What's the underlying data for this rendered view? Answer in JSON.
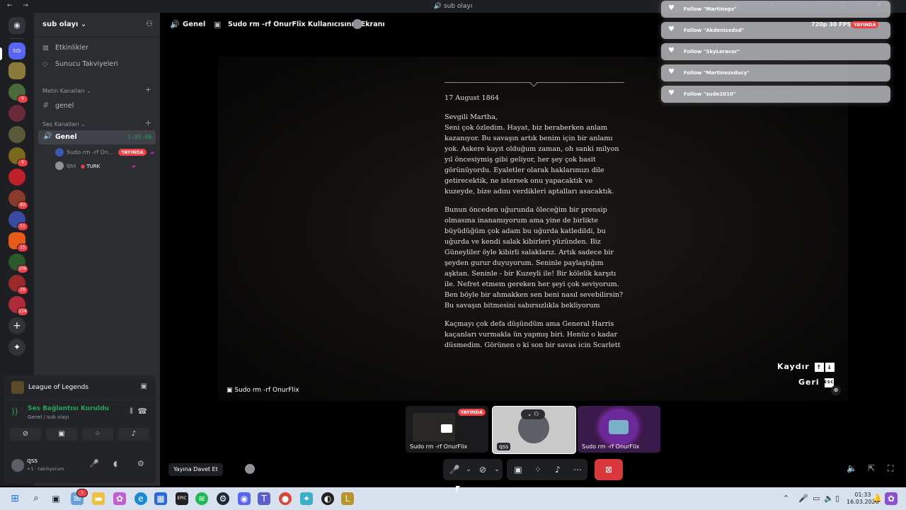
{
  "window": {
    "title": "sub olayı"
  },
  "server": {
    "name": "sub olayı"
  },
  "sidebar": {
    "top_items": [
      {
        "icon": "calendar-icon",
        "label": "Etkinlikler"
      },
      {
        "icon": "boost-icon",
        "label": "Sunucu Takviyeleri"
      }
    ],
    "text_category": "Metin Kanalları",
    "text_channel": "genel",
    "voice_category": "Ses Kanalları",
    "voice_channel": {
      "name": "Genel",
      "time": "1:05:09"
    },
    "voice_users": [
      {
        "name": "Sudo rm -rf On...",
        "badge": "YAYINDA"
      },
      {
        "name": "qss",
        "tag": "TURK"
      }
    ]
  },
  "guild_badges": [
    "9",
    "9",
    "80",
    "51",
    "15",
    "106",
    "29",
    "124"
  ],
  "panel": {
    "game": "League of Legends",
    "connection": {
      "status": "Ses Bağlantısı Kuruldu",
      "location": "Genel / sub olayı"
    },
    "user": {
      "name": "qss",
      "status": "+1 · takılıyorum"
    }
  },
  "header": {
    "channel": "Genel",
    "stream_title": "Sudo rm -rf OnurFlix Kullanıcısının Ekranı"
  },
  "letter": {
    "date": "17 August 1864",
    "paragraphs": [
      "Sevgili Martha,\nSeni çok özledim. Hayat, biz beraberken anlam kazanıyor. Bu savaşın artık benim için bir anlamı yok. Askere kayıt olduğum zaman, oh sanki milyon yıl öncesiymiş gibi geliyor, her şey çok basit görünüyordu. Eyaletler olarak haklarımızı dile getirecektik, ne istersek onu yapacaktık ve kuzeyde, bize adını verdikleri aptalları asacaktık.",
      "Bunun önceden uğurunda öleceğim bir prensip olmasına inanamıyorum ama yine de birlikte büyüdüğüm çok adam bu uğurda katledildi, bu uğurda ve kendi salak kibirleri yüzünden. Biz Güneyliler öyle kibirli salaklarız. Artık sadece bir şeyden gurur duyuyorum. Seninle paylaştığım aşktan. Seninle - bir Kuzeyli ile! Bir kölelik karşıtı ile. Nefret etmem gereken her şeyi çok seviyorum. Ben böyle bir ahmakken sen beni nasıl sevebilirsin? Bu savaşın bitmesini sabırsızlıkla bekliyorum",
      "Kaçmayı çok defa düşündüm ama General Harris kaçanları vurmakla ün yapmış biri. Henüz o kadar düşmedim. Görünen o ki son bir savaş için Scarlett"
    ]
  },
  "game_hints": {
    "scroll": "Kaydır",
    "back": "Geri",
    "esc_key": "ESC"
  },
  "stream_label": "Sudo rm -rf OnurFlix",
  "tiles": [
    {
      "label": "Sudo rm -rf OnurFlix",
      "badge": "YAYINDA"
    },
    {
      "label": "qss"
    },
    {
      "label": "Sudo rm -rf OnurFlix"
    }
  ],
  "overlay": {
    "follows": [
      "Follow \"Martinepz\"",
      "Follow \"Akdenizxdxd\"",
      "Follow \"SkyLeracer\"",
      "Follow \"Martinezxducy\"",
      "Follow \"sude2010\""
    ],
    "quality": "720p 30 FPS",
    "live": "YAYINDA"
  },
  "controls": {
    "invite": "Yayına Davet Et"
  },
  "taskbar": {
    "time": "01:33",
    "date": "16.03.2026",
    "mail_badge": "1"
  },
  "colors": {
    "accent": "#5865f2",
    "live": "#f23f43",
    "connected": "#23a55a",
    "end_call": "#da373c"
  }
}
